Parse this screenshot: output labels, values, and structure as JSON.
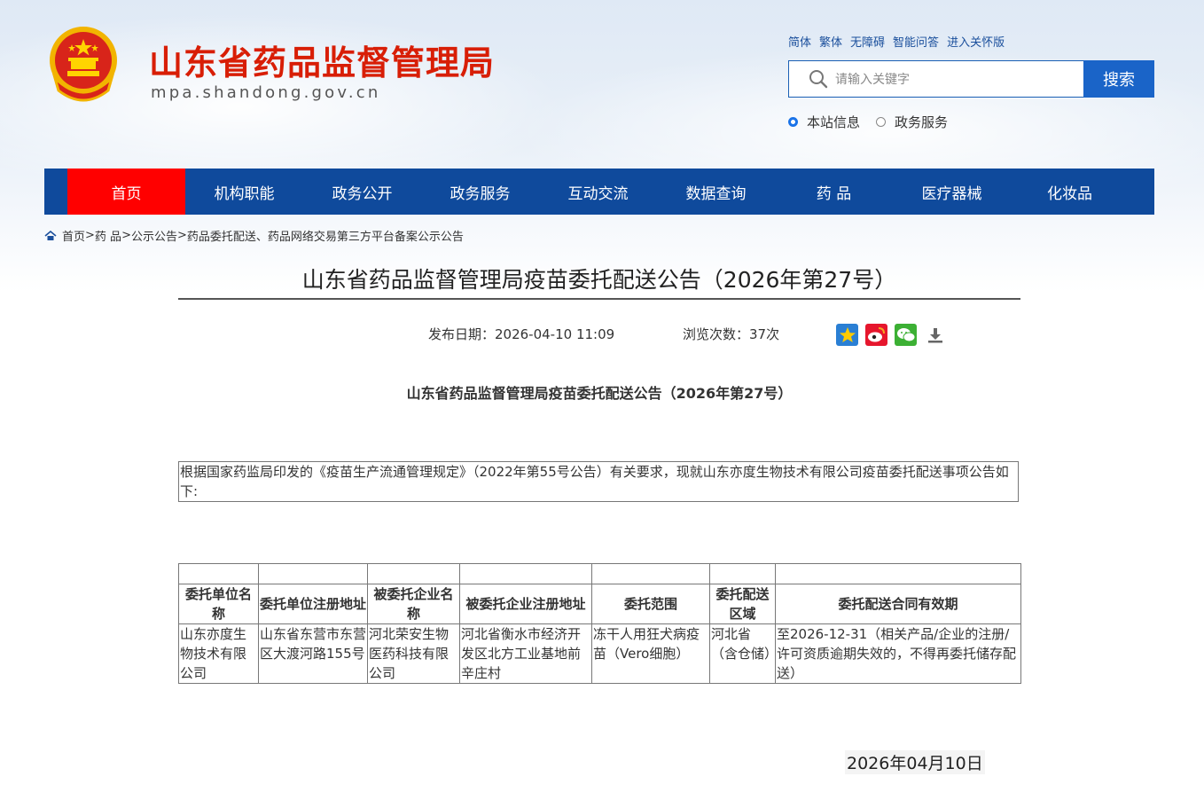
{
  "header": {
    "title": "山东省药品监督管理局",
    "url": "mpa.shandong.gov.cn",
    "links": [
      "简体",
      "繁体",
      "无障碍",
      "智能问答",
      "进入关怀版"
    ],
    "search": {
      "placeholder": "请输入关键字",
      "button": "搜索"
    },
    "scope": {
      "options": [
        "本站信息",
        "政务服务"
      ],
      "selected": "本站信息"
    }
  },
  "nav": {
    "items": [
      "首页",
      "机构职能",
      "政务公开",
      "政务服务",
      "互动交流",
      "数据查询",
      "药 品",
      "医疗器械",
      "化妆品"
    ],
    "active": "首页"
  },
  "breadcrumb": {
    "items": [
      "首页",
      "药 品",
      "公示公告",
      "药品委托配送、药品网络交易第三方平台备案公示公告"
    ],
    "sep1": "> ",
    "sep": " > "
  },
  "article": {
    "title": "山东省药品监督管理局疫苗委托配送公告（2026年第27号）",
    "publish": "发布日期：2026-04-10 11:09",
    "views": "浏览次数：37次",
    "inner_title": "山东省药品监督管理局疫苗委托配送公告（2026年第27号）",
    "intro": "根据国家药监局印发的《疫苗生产流通管理规定》（2022年第55号公告）有关要求，现就山东亦度生物技术有限公司疫苗委托配送事项公告如下:",
    "table": {
      "headers": [
        "委托单位名称",
        "委托单位注册地址",
        "被委托企业名称",
        "被委托企业注册地址",
        "委托范围",
        "委托配送区域",
        "委托配送合同有效期"
      ],
      "rows": [
        [
          "山东亦度生物技术有限公司",
          "山东省东营市东营区大渡河路155号",
          "河北荣安生物医药科技有限公司",
          "河北省衡水市经济开发区北方工业基地前辛庄村",
          "冻干人用狂犬病疫苗（Vero细胞）",
          "河北省（含仓储）",
          "至2026-12-31（相关产品/企业的注册/许可资质逾期失效的，不得再委托储存配送）"
        ]
      ]
    },
    "date": "2026年04月10日"
  },
  "icons": {
    "emblem": "national-emblem",
    "search": "search-icon",
    "home": "home-icon",
    "share": [
      "qzone-star-icon",
      "weibo-icon",
      "wechat-icon",
      "download-icon"
    ]
  },
  "colors": {
    "nav_bg": "#0f4a9c",
    "nav_active": "#ff0000",
    "title_red": "#d81e06",
    "search_btn": "#1a64c8"
  }
}
